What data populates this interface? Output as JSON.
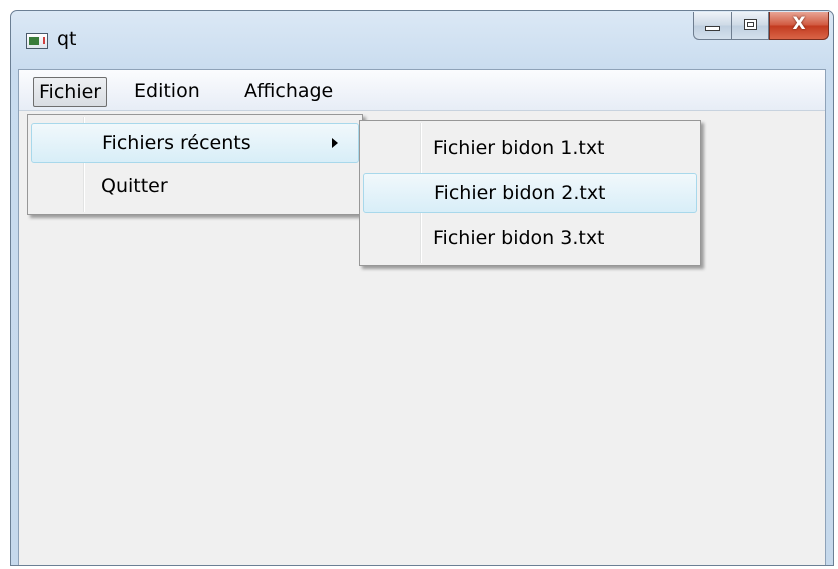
{
  "window": {
    "title": "qt",
    "app_icon": "qt-app-icon",
    "buttons": {
      "minimize": "minimize-icon",
      "maximize": "maximize-icon",
      "close_glyph": "X"
    }
  },
  "menubar": {
    "items": [
      "Fichier",
      "Edition",
      "Affichage"
    ],
    "active": "Fichier"
  },
  "fichier_menu": {
    "items": [
      {
        "label": "Fichiers récents",
        "has_submenu": true,
        "highlighted": true
      },
      {
        "label": "Quitter",
        "has_submenu": false,
        "highlighted": false
      }
    ]
  },
  "recent_submenu": {
    "items": [
      {
        "label": "Fichier bidon 1.txt",
        "highlighted": false
      },
      {
        "label": "Fichier bidon 2.txt",
        "highlighted": true
      },
      {
        "label": "Fichier bidon 3.txt",
        "highlighted": false
      }
    ]
  },
  "colors": {
    "menu_highlight": "#d8eef8",
    "menu_highlight_border": "#a8d8eb",
    "close_button": "#c94a2d",
    "client_background": "#f0f0f0"
  }
}
